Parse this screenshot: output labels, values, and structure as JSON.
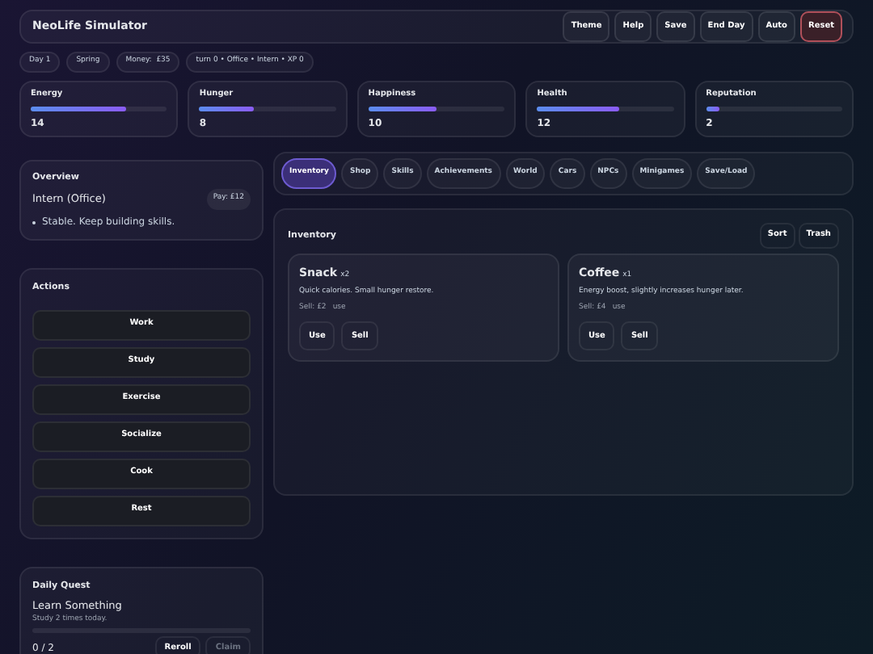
{
  "header": {
    "title": "NeoLife Simulator",
    "buttons": [
      {
        "label": "Theme",
        "kind": "normal"
      },
      {
        "label": "Help",
        "kind": "normal"
      },
      {
        "label": "Save",
        "kind": "normal"
      },
      {
        "label": "End Day",
        "kind": "normal"
      },
      {
        "label": "Auto",
        "kind": "normal"
      },
      {
        "label": "Reset",
        "kind": "danger"
      }
    ]
  },
  "chips": [
    "Day 1",
    "Spring",
    "Money:  £35",
    "turn 0 • Office • Intern • XP 0"
  ],
  "stats": [
    {
      "name": "Energy",
      "level": 0.7,
      "value": "14"
    },
    {
      "name": "Hunger",
      "level": 0.4,
      "value": "8"
    },
    {
      "name": "Happiness",
      "level": 0.5,
      "value": "10"
    },
    {
      "name": "Health",
      "level": 0.6,
      "value": "12"
    },
    {
      "name": "Reputation",
      "level": 0.1,
      "value": "2"
    }
  ],
  "overview": {
    "title": "Overview",
    "job": "Intern (Office)",
    "pay": "Pay: £12",
    "notes": [
      "Stable. Keep building skills."
    ]
  },
  "actions": {
    "title": "Actions",
    "buttons": [
      "Work",
      "Study",
      "Exercise",
      "Socialize",
      "Cook",
      "Rest"
    ]
  },
  "daily_quest": {
    "title": "Daily Quest",
    "name": "Learn Something",
    "description": "Study 2 times today.",
    "level": 0,
    "progress": "0 / 2",
    "buttons": [
      {
        "label": "Reroll",
        "disabled": false
      },
      {
        "label": "Claim",
        "disabled": true
      }
    ]
  },
  "tabs": [
    {
      "label": "Inventory",
      "selected": true
    },
    {
      "label": "Shop",
      "selected": false
    },
    {
      "label": "Skills",
      "selected": false
    },
    {
      "label": "Achievements",
      "selected": false
    },
    {
      "label": "World",
      "selected": false
    },
    {
      "label": "Cars",
      "selected": false
    },
    {
      "label": "NPCs",
      "selected": false
    },
    {
      "label": "Minigames",
      "selected": false
    },
    {
      "label": "Save/Load",
      "selected": false
    }
  ],
  "inventory": {
    "title": "Inventory",
    "buttons": [
      "Sort",
      "Trash"
    ],
    "items": [
      {
        "name": "Snack",
        "qty": "x2",
        "description": "Quick calories. Small hunger restore.",
        "sell": "Sell: £2",
        "tag": "use",
        "buttons": [
          "Use",
          "Sell"
        ]
      },
      {
        "name": "Coffee",
        "qty": "x1",
        "description": "Energy boost, slightly increases hunger later.",
        "sell": "Sell: £4",
        "tag": "use",
        "buttons": [
          "Use",
          "Sell"
        ]
      }
    ]
  }
}
